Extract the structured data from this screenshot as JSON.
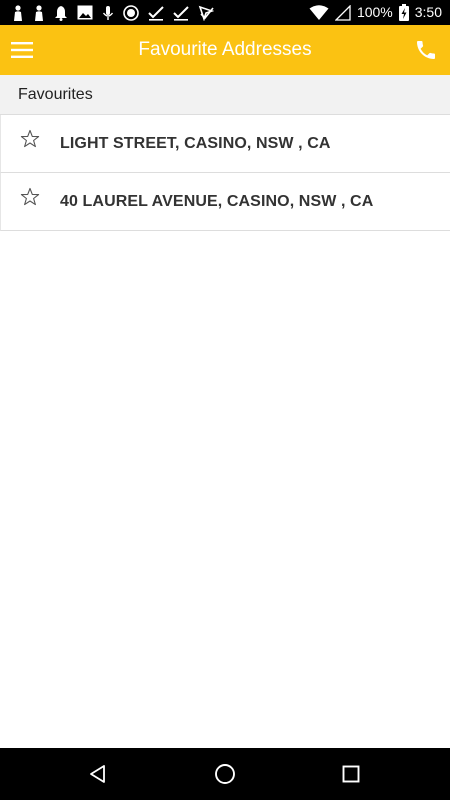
{
  "status_bar": {
    "battery": "100%",
    "time": "3:50",
    "notification_icons": [
      "person-icon",
      "person-icon",
      "bell-icon",
      "image-icon",
      "mic-icon",
      "record-icon",
      "check-icon",
      "check-icon",
      "send-icon"
    ]
  },
  "app_bar": {
    "title": "Favourite Addresses",
    "background_color": "#fbc212"
  },
  "favourites": {
    "header": "Favourites",
    "items": [
      {
        "label": "LIGHT STREET, CASINO, NSW , CA",
        "icon": "star-outline-icon"
      },
      {
        "label": "40 LAUREL AVENUE, CASINO, NSW , CA",
        "icon": "star-outline-icon"
      }
    ]
  },
  "nav_bar": {
    "buttons": [
      "back-icon",
      "home-icon",
      "recents-icon"
    ]
  }
}
